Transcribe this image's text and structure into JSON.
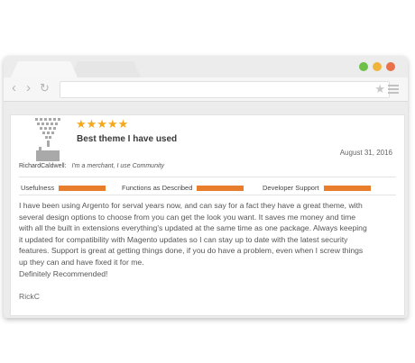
{
  "browser": {
    "window_buttons": [
      {
        "name": "green",
        "color": "#6cc04a"
      },
      {
        "name": "yellow",
        "color": "#f0b43c"
      },
      {
        "name": "red",
        "color": "#e8704a"
      }
    ],
    "nav": {
      "back_icon": "chevron-left-icon",
      "forward_icon": "chevron-right-icon",
      "reload_icon": "reload-icon"
    },
    "address_value": "",
    "bookmark_icon": "star-icon",
    "menu_icon": "hamburger-menu-icon"
  },
  "review": {
    "stars": "★★★★★",
    "rating_value": 5,
    "rating_max": 5,
    "star_color": "#f4a81a",
    "title": "Best theme I have used",
    "date": "August 31, 2016",
    "author_name": "RichardCaldwell:",
    "author_detail": "I'm a merchant, I use Community",
    "criteria": [
      {
        "label": "Usefulness",
        "bar_color": "#e87e2b"
      },
      {
        "label": "Functions as Described",
        "bar_color": "#e87e2b"
      },
      {
        "label": "Developer Support",
        "bar_color": "#e87e2b"
      }
    ],
    "body_lines": [
      "I have been using Argento for serval years now, and can say for a fact they have a great theme, with",
      "several design options to choose from you can get the look you want. It saves me money and time",
      "with all the built in extensions everything's updated at the same time as one package. Always keeping",
      "it updated for compatibility with Magento updates so I can stay up to date with the latest security",
      "features. Support is great at getting things done, if you do have a problem, even when I screw things",
      "up they can and have fixed it for me.",
      "Definitely Recommended!"
    ],
    "signature": "RickC"
  }
}
